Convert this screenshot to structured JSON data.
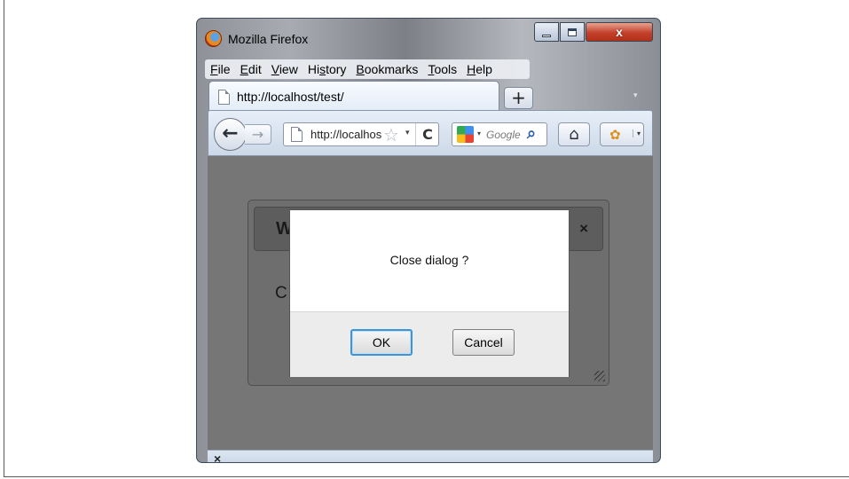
{
  "window": {
    "title": "Mozilla Firefox",
    "controls": {
      "minimize": "–",
      "maximize": "□",
      "close": "x"
    }
  },
  "menubar": {
    "items": [
      {
        "accel": "F",
        "rest": "ile"
      },
      {
        "accel": "E",
        "rest": "dit"
      },
      {
        "accel": "V",
        "rest": "iew"
      },
      {
        "pre": "Hi",
        "accel": "s",
        "rest": "tory"
      },
      {
        "accel": "B",
        "rest": "ookmarks"
      },
      {
        "accel": "T",
        "rest": "ools"
      },
      {
        "accel": "H",
        "rest": "elp"
      }
    ]
  },
  "tabs": [
    {
      "title": "http://localhost/test/"
    }
  ],
  "tabstrip": {
    "new_tab": "+",
    "all_tabs": "▾"
  },
  "navbar": {
    "back": "←",
    "forward": "→",
    "url": "http://localhost/test/",
    "star": "☆",
    "history_dropdown": "▾",
    "reload": "C",
    "search_engine": "Google",
    "search_dropdown": "▾",
    "search_glyph": "⌕",
    "home": "⌂",
    "addon": "✿",
    "addon_dropdown": "▾"
  },
  "page": {
    "background_dialog": {
      "title": "W",
      "close": "×",
      "body": "C"
    },
    "modal": {
      "message": "Close dialog ?",
      "ok_label": "OK",
      "cancel_label": "Cancel"
    }
  },
  "statusbar": {
    "close": "×"
  },
  "colors": {
    "overlay": "#767676",
    "ok_focus_border": "#3d95d6",
    "window_close": "#c4412b",
    "navbar": "#cdd9e8"
  }
}
